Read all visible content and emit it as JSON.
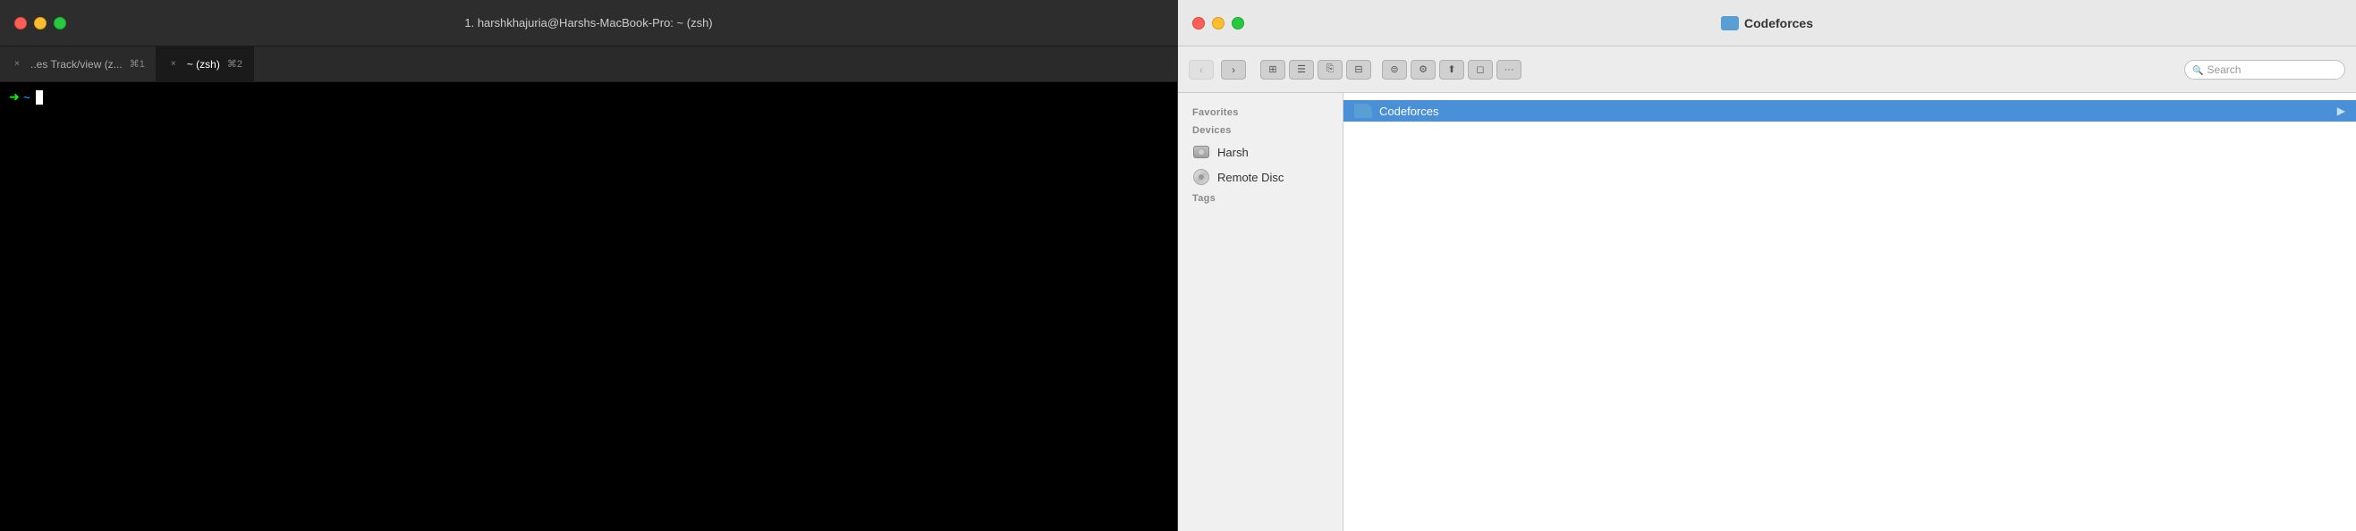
{
  "terminal": {
    "window_title": "1. harshkhajuria@Harshs-MacBook-Pro: ~ (zsh)",
    "tab1": {
      "close_btn": "×",
      "label": "..es Track/view (z...",
      "shortcut_symbol": "⌘",
      "shortcut_num": "1"
    },
    "tab2": {
      "close_btn": "×",
      "label": "~ (zsh)",
      "shortcut_symbol": "⌘",
      "shortcut_num": "2"
    },
    "prompt_arrow": "➜",
    "prompt_tilde": "~"
  },
  "finder": {
    "window_title": "Codeforces",
    "sidebar": {
      "favorites_label": "Favorites",
      "devices_label": "Devices",
      "tags_label": "Tags",
      "devices": [
        {
          "name": "Harsh",
          "type": "hdd"
        },
        {
          "name": "Remote Disc",
          "type": "disc"
        }
      ]
    },
    "toolbar": {
      "search_placeholder": "Search",
      "back_btn": "‹",
      "forward_btn": "›"
    },
    "main": {
      "folder_name": "Codeforces"
    }
  },
  "colors": {
    "terminal_bg": "#000000",
    "terminal_titlebar": "#2d2d2d",
    "finder_bg": "#ffffff",
    "finder_sidebar_bg": "#f0f0f0",
    "folder_highlight": "#4a90d9",
    "folder_icon_blue": "#5a9fd4",
    "prompt_green": "#00ff00",
    "prompt_blue": "#00aaff"
  }
}
